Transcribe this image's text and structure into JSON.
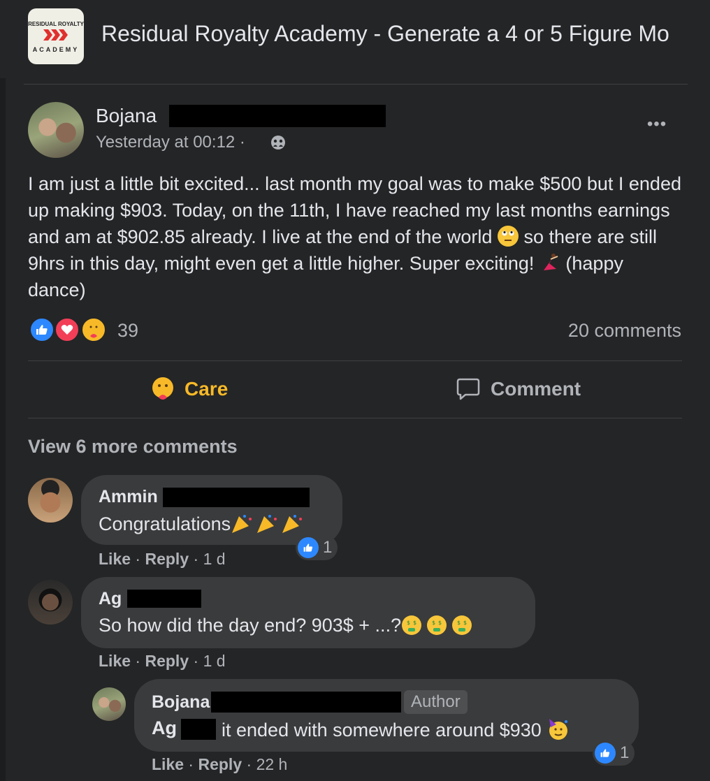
{
  "group": {
    "logo_line1": "RESIDUAL ROYALTY",
    "logo_line2": "ACADEMY",
    "title": "Residual Royalty Academy - Generate a 4 or 5 Figure Mo"
  },
  "post": {
    "author": "Bojana",
    "timestamp": "Yesterday at 00:12 ·",
    "privacy_icon": "group-members-icon",
    "body_part1": "I am just a little bit excited... last month my goal was to make $500 but I ended up making $903. Today, on the 11th, I have reached my last months earnings and am at $902.85 already. I live at the end of the world ",
    "body_part2": " so there are still 9hrs in this day, might even get a little higher. Super exciting! ",
    "body_part3": " (happy dance)",
    "reaction_count": "39",
    "comment_count": "20 comments"
  },
  "actions": {
    "care_label": "Care",
    "comment_label": "Comment"
  },
  "comments": {
    "view_more": "View 6 more comments",
    "items": [
      {
        "author": "Ammin",
        "text": "Congratulations",
        "like": "Like",
        "reply": "Reply",
        "age": "1 d",
        "reactions": "1"
      },
      {
        "author": "Ag",
        "text": "So how did the day end? 903$ + ...?",
        "like": "Like",
        "reply": "Reply",
        "age": "1 d"
      },
      {
        "author": "Bojana",
        "badge": "Author",
        "mention": "Ag",
        "text": "it ended with somewhere around $930",
        "like": "Like",
        "reply": "Reply",
        "age": "22 h",
        "reactions": "1"
      }
    ]
  },
  "colors": {
    "background": "#242526",
    "bubble": "#3a3b3c",
    "care": "#f7b928",
    "like_blue": "#2d88ff",
    "love_red": "#f33e58"
  }
}
